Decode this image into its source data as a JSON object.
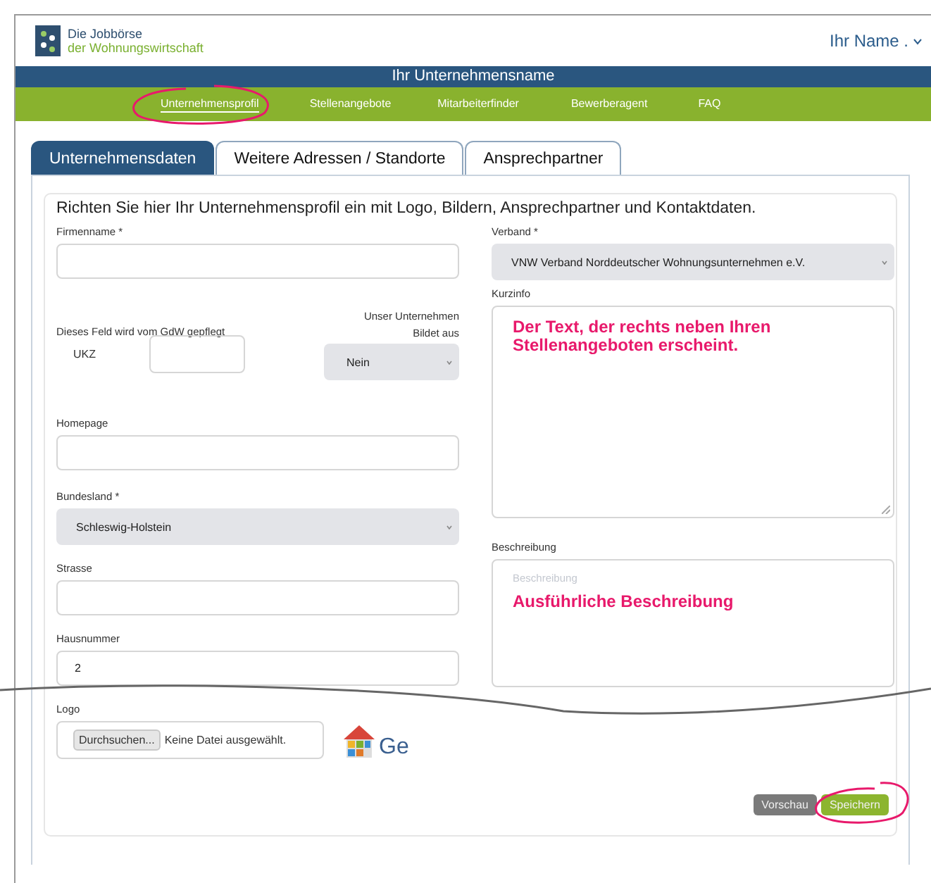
{
  "header": {
    "logo_line_1": "Die Jobbörse",
    "logo_line_2": "der Wohnungswirtschaft",
    "user_menu": "Ihr Name ."
  },
  "company_bar": {
    "title": "Ihr Unternehmensname"
  },
  "nav": [
    {
      "label": "Unternehmensprofil",
      "selected": true,
      "circled": true
    },
    {
      "label": "Stellenangebote",
      "selected": false,
      "circled": false
    },
    {
      "label": "Mitarbeiterfinder",
      "selected": false,
      "circled": false
    },
    {
      "label": "Bewerberagent",
      "selected": false,
      "circled": false
    },
    {
      "label": "FAQ",
      "selected": false,
      "circled": false
    }
  ],
  "tabs": [
    {
      "label": "Unternehmensdaten",
      "selected": true
    },
    {
      "label": "Weitere Adressen / Standorte",
      "selected": false
    },
    {
      "label": "Ansprechpartner",
      "selected": false
    }
  ],
  "form": {
    "intro": "Richten Sie hier Ihr Unternehmensprofil ein mit Logo, Bildern, Ansprechpartner und Kontaktdaten.",
    "left": [
      {
        "kind": "text",
        "label": "Firmenname *"
      },
      {
        "kind": "ukz",
        "note": "Dieses Feld wird vom GdW gepflegt",
        "label": "UKZ",
        "side_label_lines": [
          "Unser Unternehmen",
          "Bildet aus"
        ],
        "side_value": "Nein"
      },
      {
        "kind": "text",
        "label": "Homepage"
      },
      {
        "kind": "select",
        "label": "Bundesland *",
        "value": "Schleswig-Holstein"
      },
      {
        "kind": "text",
        "label": "Strasse"
      },
      {
        "kind": "text",
        "label": "Hausnummer",
        "value": "2"
      },
      {
        "kind": "file",
        "label": "Logo",
        "button": "Durchsuchen...",
        "status": "Keine Datei ausgewählt.",
        "logo_text": "Ge"
      }
    ],
    "right": [
      {
        "kind": "select",
        "label": "Verband *",
        "value": "VNW Verband Norddeutscher Wohnungsunternehmen e.V."
      },
      {
        "kind": "textarea",
        "label": "Kurzinfo",
        "note": "Der Text, der rechts neben Ihren Stellenangeboten erscheint.",
        "resizable": true
      },
      {
        "kind": "textarea",
        "label": "Beschreibung",
        "placeholder": "Beschreibung",
        "note": "Ausführliche Beschreibung",
        "resizable": false
      }
    ],
    "buttons": [
      {
        "label": "Vorschau",
        "kind": "secondary",
        "circled": false
      },
      {
        "label": "Speichern",
        "kind": "primary",
        "circled": true
      }
    ]
  },
  "annotations": {
    "cut_line": true
  }
}
